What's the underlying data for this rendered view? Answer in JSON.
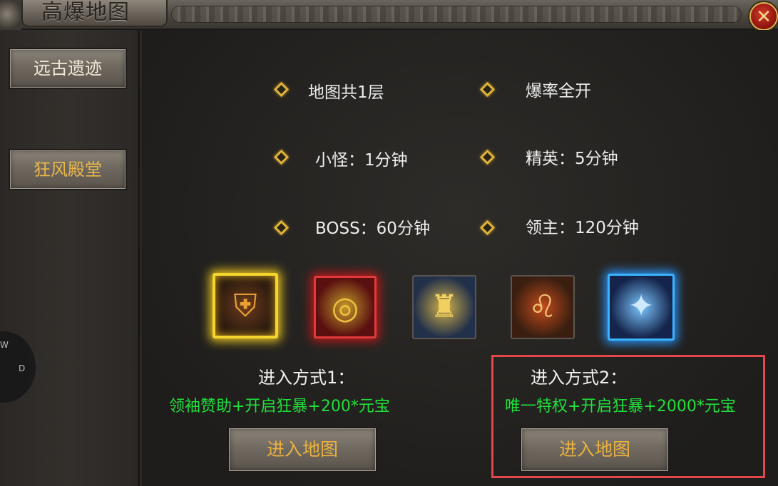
{
  "window": {
    "title": "高爆地图",
    "close_icon": "close-x-icon"
  },
  "sidebar": {
    "items": [
      {
        "label": "远古遗迹"
      },
      {
        "label": "狂风殿堂"
      }
    ]
  },
  "minimap": {
    "w": "W",
    "d": "D"
  },
  "info": {
    "floors": "地图共1层",
    "drop_rate": "爆率全开",
    "minion": "小怪：1分钟",
    "elite": "精英：5分钟",
    "boss": "BOSS：60分钟",
    "lord": "领主：120分钟"
  },
  "rewards": {
    "icons": [
      "golden-shield-icon",
      "red-ring-icon",
      "golden-armor-icon",
      "lion-head-icon",
      "blue-wings-icon"
    ]
  },
  "methods": [
    {
      "title": "进入方式1：",
      "desc": "领袖赞助+开启狂暴+200*元宝",
      "button": "进入地图"
    },
    {
      "title": "进入方式2：",
      "desc": "唯一特权+开启狂暴+2000*元宝",
      "button": "进入地图"
    }
  ],
  "colors": {
    "gold": "#e0b43a",
    "green": "#1fe03a",
    "highlight": "#e2474a"
  }
}
